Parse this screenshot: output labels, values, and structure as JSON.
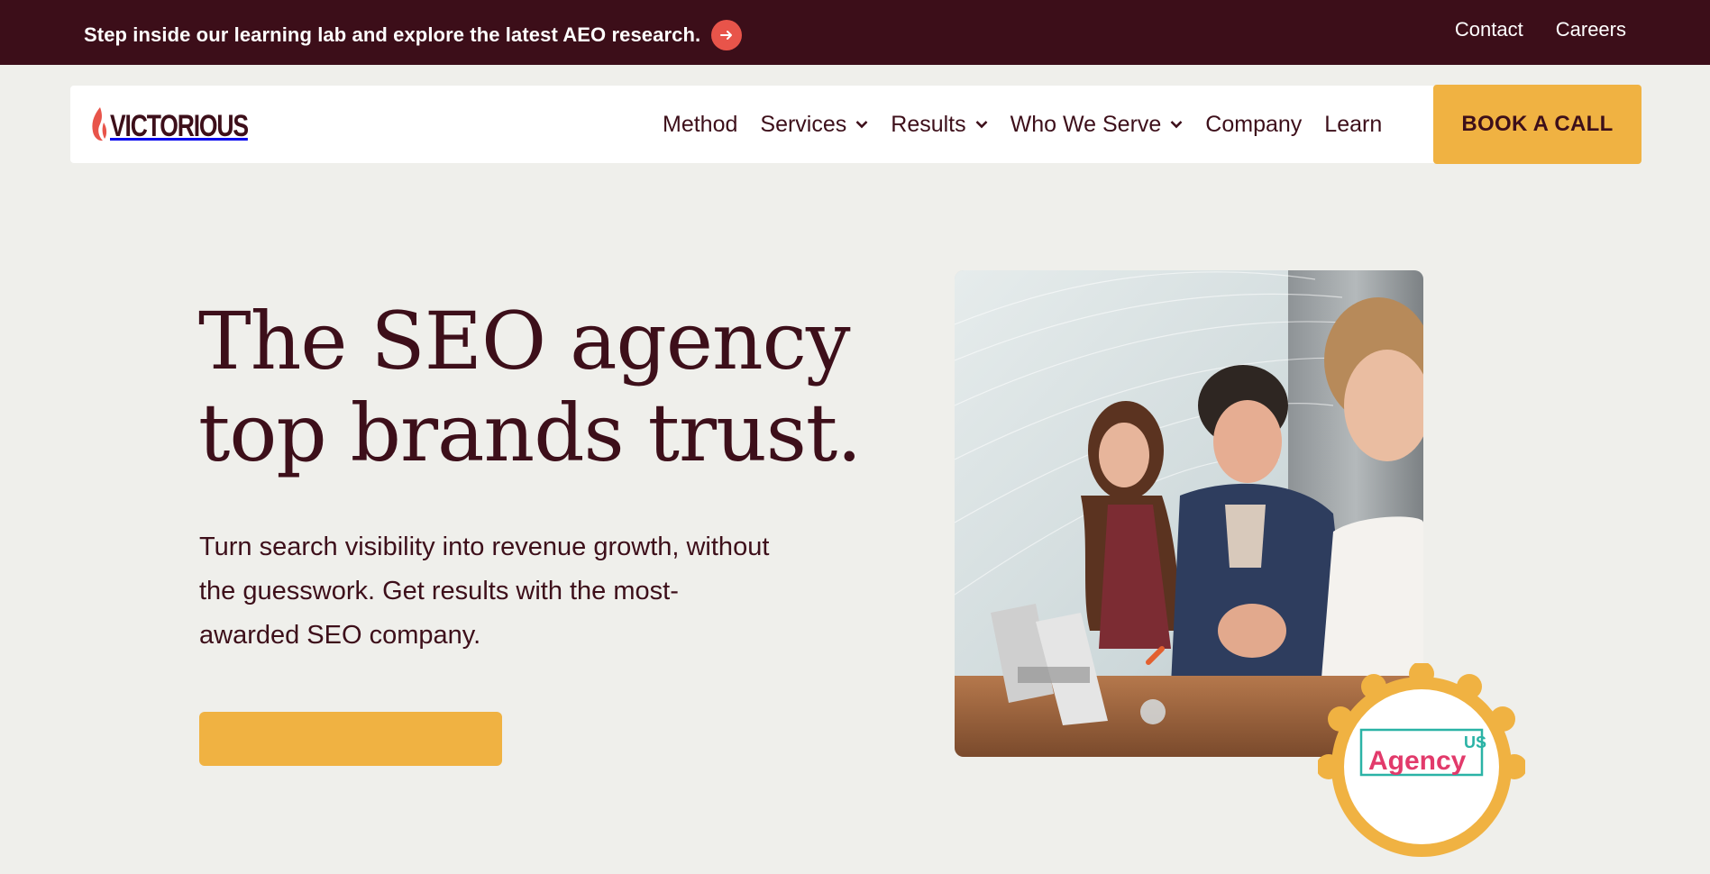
{
  "announcement": {
    "message": "Step inside our learning lab and explore the latest AEO research.",
    "arrow_icon": "arrow-right-icon"
  },
  "utility_nav": {
    "contact": "Contact",
    "careers": "Careers"
  },
  "brand": {
    "logo_text": "VICTORIOUS",
    "flame_color": "#e8544a"
  },
  "main_nav": {
    "items": [
      {
        "label": "Method",
        "has_dropdown": false
      },
      {
        "label": "Services",
        "has_dropdown": true
      },
      {
        "label": "Results",
        "has_dropdown": true
      },
      {
        "label": "Who We Serve",
        "has_dropdown": true
      },
      {
        "label": "Company",
        "has_dropdown": false
      },
      {
        "label": "Learn",
        "has_dropdown": false
      }
    ],
    "cta": "BOOK A CALL"
  },
  "hero": {
    "title": "The SEO agency top brands trust.",
    "subtitle": "Turn search visibility into revenue growth, without the guesswork. Get results with the most-awarded SEO company."
  },
  "badge": {
    "top_text": "US",
    "main_text": "Agency"
  },
  "colors": {
    "maroon": "#3c0e19",
    "accent_yellow": "#f0b242",
    "accent_red": "#e8544a",
    "page_bg": "#efefeb"
  }
}
